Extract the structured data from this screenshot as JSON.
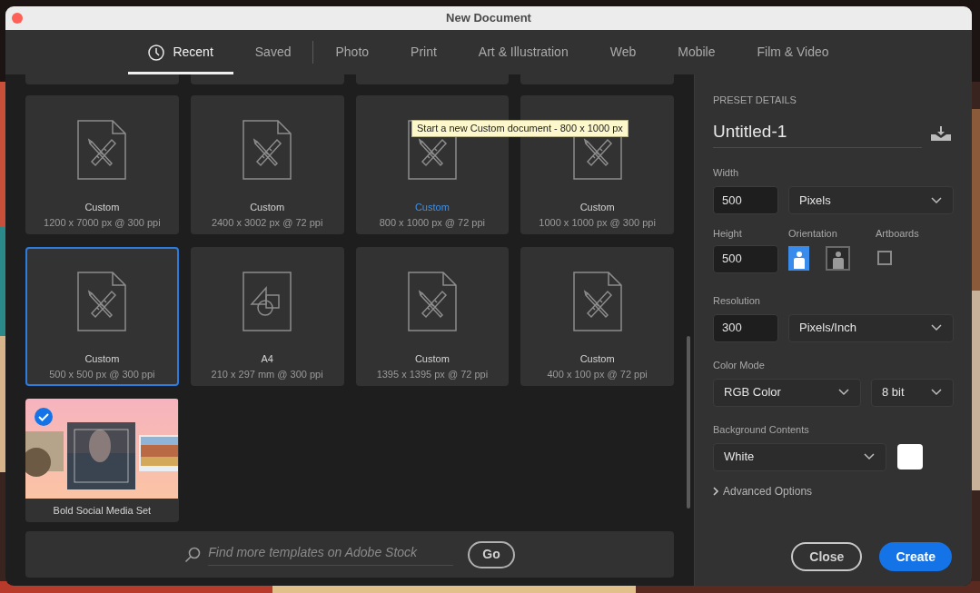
{
  "window": {
    "title": "New Document"
  },
  "tabs": [
    {
      "label": "Recent",
      "selected": true,
      "kind": "history",
      "divider_after": false
    },
    {
      "label": "Saved",
      "selected": false,
      "kind": "tab",
      "divider_after": true
    },
    {
      "label": "Photo",
      "selected": false,
      "kind": "tab",
      "divider_after": false
    },
    {
      "label": "Print",
      "selected": false,
      "kind": "tab",
      "divider_after": false
    },
    {
      "label": "Art & Illustration",
      "selected": false,
      "kind": "tab",
      "divider_after": false
    },
    {
      "label": "Web",
      "selected": false,
      "kind": "tab",
      "divider_after": false
    },
    {
      "label": "Mobile",
      "selected": false,
      "kind": "tab",
      "divider_after": false
    },
    {
      "label": "Film & Video",
      "selected": false,
      "kind": "tab",
      "divider_after": false
    }
  ],
  "presets": [
    {
      "kind": "custom",
      "name": "Custom",
      "size": "1200 x 7000 px @ 300 ppi",
      "selected": false,
      "hovered": false
    },
    {
      "kind": "custom",
      "name": "Custom",
      "size": "2400 x 3002 px @ 72 ppi",
      "selected": false,
      "hovered": false
    },
    {
      "kind": "custom",
      "name": "Custom",
      "size": "800 x 1000 px @ 72 ppi",
      "selected": false,
      "hovered": true
    },
    {
      "kind": "custom",
      "name": "Custom",
      "size": "1000 x 1000 px @ 300 ppi",
      "selected": false,
      "hovered": false
    },
    {
      "kind": "custom",
      "name": "Custom",
      "size": "500 x 500 px @ 300 ppi",
      "selected": true,
      "hovered": false
    },
    {
      "kind": "print",
      "name": "A4",
      "size": "210 x 297 mm @ 300 ppi",
      "selected": false,
      "hovered": false
    },
    {
      "kind": "custom",
      "name": "Custom",
      "size": "1395 x 1395 px @ 72 ppi",
      "selected": false,
      "hovered": false
    },
    {
      "kind": "custom",
      "name": "Custom",
      "size": "400 x 100 px @ 72 ppi",
      "selected": false,
      "hovered": false
    },
    {
      "kind": "template",
      "name": "Bold Social Media Set",
      "checked": true
    }
  ],
  "tooltip": {
    "text": "Start a new Custom document - 800 x 1000 px"
  },
  "search": {
    "placeholder": "Find more templates on Adobe Stock",
    "button": "Go"
  },
  "preset_details": {
    "heading": "PRESET DETAILS",
    "name": "Untitled-1",
    "width": {
      "label": "Width",
      "value": "500",
      "unit": "Pixels"
    },
    "height": {
      "label": "Height",
      "value": "500"
    },
    "orientation": {
      "label": "Orientation",
      "options": [
        {
          "kind": "portrait",
          "selected": true
        },
        {
          "kind": "landscape",
          "selected": false
        }
      ]
    },
    "artboards": {
      "label": "Artboards",
      "checked": false
    },
    "resolution": {
      "label": "Resolution",
      "value": "300",
      "unit": "Pixels/Inch"
    },
    "color_mode": {
      "label": "Color Mode",
      "mode": "RGB Color",
      "depth": "8 bit"
    },
    "background": {
      "label": "Background Contents",
      "value": "White",
      "color": "#ffffff"
    },
    "advanced": {
      "label": "Advanced Options",
      "expanded": false
    }
  },
  "buttons": [
    {
      "label": "Close",
      "kind": "secondary"
    },
    {
      "label": "Create",
      "kind": "primary"
    }
  ]
}
